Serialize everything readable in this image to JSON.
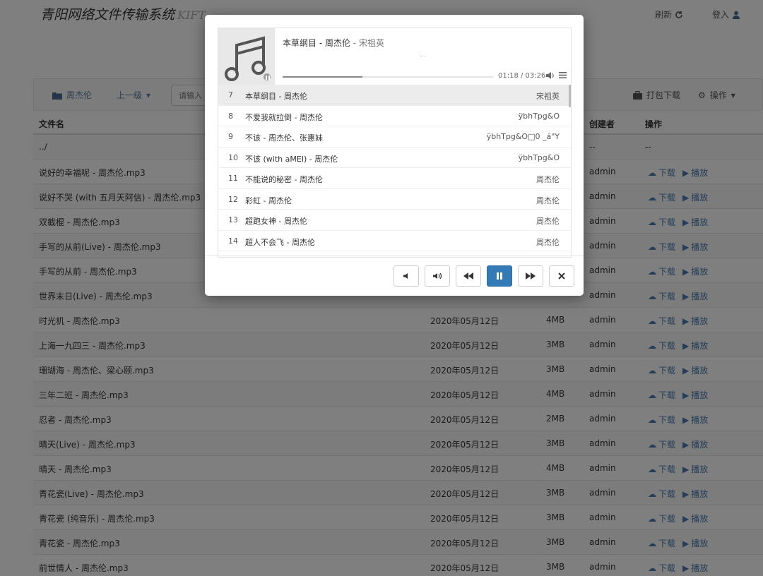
{
  "header": {
    "brand": "青阳网络文件传输系统",
    "brand_sub": "KIFT",
    "refresh": "刷新",
    "login": "登入"
  },
  "toolbar": {
    "folder": "周杰伦",
    "up": "上一级",
    "search_placeholder": "请输入",
    "pack_download": "打包下载",
    "operations": "操作"
  },
  "table": {
    "headers": {
      "name": "文件名",
      "owner": "创建者",
      "ops": "操作"
    },
    "parent_row": {
      "name": "../",
      "owner": "--",
      "ops": "--"
    },
    "download_label": "下载",
    "play_label": "播放",
    "rows": [
      {
        "name": "说好的幸福呢 - 周杰伦.mp3",
        "date": "",
        "size": "",
        "owner": "admin"
      },
      {
        "name": "说好不哭 (with 五月天阿信) - 周杰伦.mp3",
        "date": "",
        "size": "",
        "owner": "admin"
      },
      {
        "name": "双截棍 - 周杰伦.mp3",
        "date": "",
        "size": "",
        "owner": "admin"
      },
      {
        "name": "手写的从前(Live) - 周杰伦.mp3",
        "date": "",
        "size": "",
        "owner": "admin"
      },
      {
        "name": "手写的从前 - 周杰伦.mp3",
        "date": "",
        "size": "",
        "owner": "admin"
      },
      {
        "name": "世界末日(Live) - 周杰伦.mp3",
        "date": "",
        "size": "",
        "owner": "admin"
      },
      {
        "name": "时光机 - 周杰伦.mp3",
        "date": "2020年05月12日",
        "size": "4MB",
        "owner": "admin"
      },
      {
        "name": "上海一九四三 - 周杰伦.mp3",
        "date": "2020年05月12日",
        "size": "3MB",
        "owner": "admin"
      },
      {
        "name": "珊瑚海 - 周杰伦、梁心颐.mp3",
        "date": "2020年05月12日",
        "size": "3MB",
        "owner": "admin"
      },
      {
        "name": "三年二班 - 周杰伦.mp3",
        "date": "2020年05月12日",
        "size": "4MB",
        "owner": "admin"
      },
      {
        "name": "忍者 - 周杰伦.mp3",
        "date": "2020年05月12日",
        "size": "2MB",
        "owner": "admin"
      },
      {
        "name": "晴天(Live) - 周杰伦.mp3",
        "date": "2020年05月12日",
        "size": "3MB",
        "owner": "admin"
      },
      {
        "name": "晴天 - 周杰伦.mp3",
        "date": "2020年05月12日",
        "size": "4MB",
        "owner": "admin"
      },
      {
        "name": "青花瓷(Live) - 周杰伦.mp3",
        "date": "2020年05月12日",
        "size": "3MB",
        "owner": "admin"
      },
      {
        "name": "青花瓷 (纯音乐) - 周杰伦.mp3",
        "date": "2020年05月12日",
        "size": "3MB",
        "owner": "admin"
      },
      {
        "name": "青花瓷 - 周杰伦.mp3",
        "date": "2020年05月12日",
        "size": "3MB",
        "owner": "admin"
      },
      {
        "name": "前世情人 - 周杰伦.mp3",
        "date": "2020年05月12日",
        "size": "3MB",
        "owner": "admin"
      }
    ]
  },
  "player": {
    "title": "本草纲目 - 周杰伦",
    "artist": "宋祖英",
    "lyric": "...",
    "time": "01:18 / 03:26",
    "progress": 0.38,
    "playlist": [
      {
        "num": "7",
        "title": "本草纲目 - 周杰伦",
        "artist": "宋祖英",
        "active": true
      },
      {
        "num": "8",
        "title": "不爱我就拉倒 - 周杰伦",
        "artist": "ÿbhTpg&O"
      },
      {
        "num": "9",
        "title": "不该 - 周杰伦、张惠妹",
        "artist": "ÿbhTpg&O□0 _á\"Y"
      },
      {
        "num": "10",
        "title": "不该 (with aMEI) - 周杰伦",
        "artist": "ÿbhTpg&O"
      },
      {
        "num": "11",
        "title": "不能说的秘密 - 周杰伦",
        "artist": "周杰伦"
      },
      {
        "num": "12",
        "title": "彩虹 - 周杰伦",
        "artist": "周杰伦"
      },
      {
        "num": "13",
        "title": "超跑女神 - 周杰伦",
        "artist": "周杰伦"
      },
      {
        "num": "14",
        "title": "超人不会飞 - 周杰伦",
        "artist": "周杰伦"
      }
    ]
  }
}
